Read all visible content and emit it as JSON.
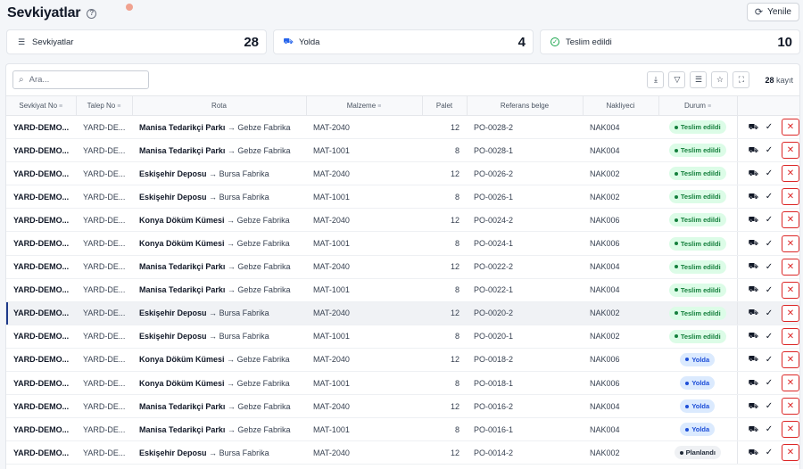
{
  "header": {
    "title": "Sevkiyatlar",
    "help_glyph": "?",
    "refresh_label": "Yenile"
  },
  "stats": [
    {
      "icon": "list-icon",
      "label": "Sevkiyatlar",
      "value": "28"
    },
    {
      "icon": "truck-icon",
      "label": "Yolda",
      "value": "4"
    },
    {
      "icon": "check-circle-icon",
      "label": "Teslim edildi",
      "value": "10"
    }
  ],
  "toolbar": {
    "search_placeholder": "Ara...",
    "record_count": "28",
    "record_suffix": "kayıt"
  },
  "columns": [
    "Sevkiyat No",
    "Talep No",
    "Rota",
    "Malzeme",
    "Palet",
    "Referans belge",
    "Nakliyeci",
    "Durum"
  ],
  "colors": {
    "delivered": "#15803d",
    "transit": "#1d4ed8",
    "planned": "#1f2937",
    "danger": "#dc2626"
  },
  "rows": [
    {
      "id": "YARD-DEMO...",
      "req": "YARD-DE...",
      "from": "Manisa Tedarikçi Parkı",
      "to": "Gebze Fabrika",
      "material": "MAT-2040",
      "pallet": "12",
      "ref": "PO-0028-2",
      "carrier": "NAK004",
      "status": "Teslim edildi",
      "status_kind": "delivered"
    },
    {
      "id": "YARD-DEMO...",
      "req": "YARD-DE...",
      "from": "Manisa Tedarikçi Parkı",
      "to": "Gebze Fabrika",
      "material": "MAT-1001",
      "pallet": "8",
      "ref": "PO-0028-1",
      "carrier": "NAK004",
      "status": "Teslim edildi",
      "status_kind": "delivered"
    },
    {
      "id": "YARD-DEMO...",
      "req": "YARD-DE...",
      "from": "Eskişehir Deposu",
      "to": "Bursa Fabrika",
      "material": "MAT-2040",
      "pallet": "12",
      "ref": "PO-0026-2",
      "carrier": "NAK002",
      "status": "Teslim edildi",
      "status_kind": "delivered"
    },
    {
      "id": "YARD-DEMO...",
      "req": "YARD-DE...",
      "from": "Eskişehir Deposu",
      "to": "Bursa Fabrika",
      "material": "MAT-1001",
      "pallet": "8",
      "ref": "PO-0026-1",
      "carrier": "NAK002",
      "status": "Teslim edildi",
      "status_kind": "delivered"
    },
    {
      "id": "YARD-DEMO...",
      "req": "YARD-DE...",
      "from": "Konya Döküm Kümesi",
      "to": "Gebze Fabrika",
      "material": "MAT-2040",
      "pallet": "12",
      "ref": "PO-0024-2",
      "carrier": "NAK006",
      "status": "Teslim edildi",
      "status_kind": "delivered"
    },
    {
      "id": "YARD-DEMO...",
      "req": "YARD-DE...",
      "from": "Konya Döküm Kümesi",
      "to": "Gebze Fabrika",
      "material": "MAT-1001",
      "pallet": "8",
      "ref": "PO-0024-1",
      "carrier": "NAK006",
      "status": "Teslim edildi",
      "status_kind": "delivered"
    },
    {
      "id": "YARD-DEMO...",
      "req": "YARD-DE...",
      "from": "Manisa Tedarikçi Parkı",
      "to": "Gebze Fabrika",
      "material": "MAT-2040",
      "pallet": "12",
      "ref": "PO-0022-2",
      "carrier": "NAK004",
      "status": "Teslim edildi",
      "status_kind": "delivered"
    },
    {
      "id": "YARD-DEMO...",
      "req": "YARD-DE...",
      "from": "Manisa Tedarikçi Parkı",
      "to": "Gebze Fabrika",
      "material": "MAT-1001",
      "pallet": "8",
      "ref": "PO-0022-1",
      "carrier": "NAK004",
      "status": "Teslim edildi",
      "status_kind": "delivered"
    },
    {
      "id": "YARD-DEMO...",
      "req": "YARD-DE...",
      "from": "Eskişehir Deposu",
      "to": "Bursa Fabrika",
      "material": "MAT-2040",
      "pallet": "12",
      "ref": "PO-0020-2",
      "carrier": "NAK002",
      "status": "Teslim edildi",
      "status_kind": "delivered",
      "selected": true
    },
    {
      "id": "YARD-DEMO...",
      "req": "YARD-DE...",
      "from": "Eskişehir Deposu",
      "to": "Bursa Fabrika",
      "material": "MAT-1001",
      "pallet": "8",
      "ref": "PO-0020-1",
      "carrier": "NAK002",
      "status": "Teslim edildi",
      "status_kind": "delivered"
    },
    {
      "id": "YARD-DEMO...",
      "req": "YARD-DE...",
      "from": "Konya Döküm Kümesi",
      "to": "Gebze Fabrika",
      "material": "MAT-2040",
      "pallet": "12",
      "ref": "PO-0018-2",
      "carrier": "NAK006",
      "status": "Yolda",
      "status_kind": "transit"
    },
    {
      "id": "YARD-DEMO...",
      "req": "YARD-DE...",
      "from": "Konya Döküm Kümesi",
      "to": "Gebze Fabrika",
      "material": "MAT-1001",
      "pallet": "8",
      "ref": "PO-0018-1",
      "carrier": "NAK006",
      "status": "Yolda",
      "status_kind": "transit"
    },
    {
      "id": "YARD-DEMO...",
      "req": "YARD-DE...",
      "from": "Manisa Tedarikçi Parkı",
      "to": "Gebze Fabrika",
      "material": "MAT-2040",
      "pallet": "12",
      "ref": "PO-0016-2",
      "carrier": "NAK004",
      "status": "Yolda",
      "status_kind": "transit"
    },
    {
      "id": "YARD-DEMO...",
      "req": "YARD-DE...",
      "from": "Manisa Tedarikçi Parkı",
      "to": "Gebze Fabrika",
      "material": "MAT-1001",
      "pallet": "8",
      "ref": "PO-0016-1",
      "carrier": "NAK004",
      "status": "Yolda",
      "status_kind": "transit"
    },
    {
      "id": "YARD-DEMO...",
      "req": "YARD-DE...",
      "from": "Eskişehir Deposu",
      "to": "Bursa Fabrika",
      "material": "MAT-2040",
      "pallet": "12",
      "ref": "PO-0014-2",
      "carrier": "NAK002",
      "status": "Planlandı",
      "status_kind": "planned"
    }
  ]
}
